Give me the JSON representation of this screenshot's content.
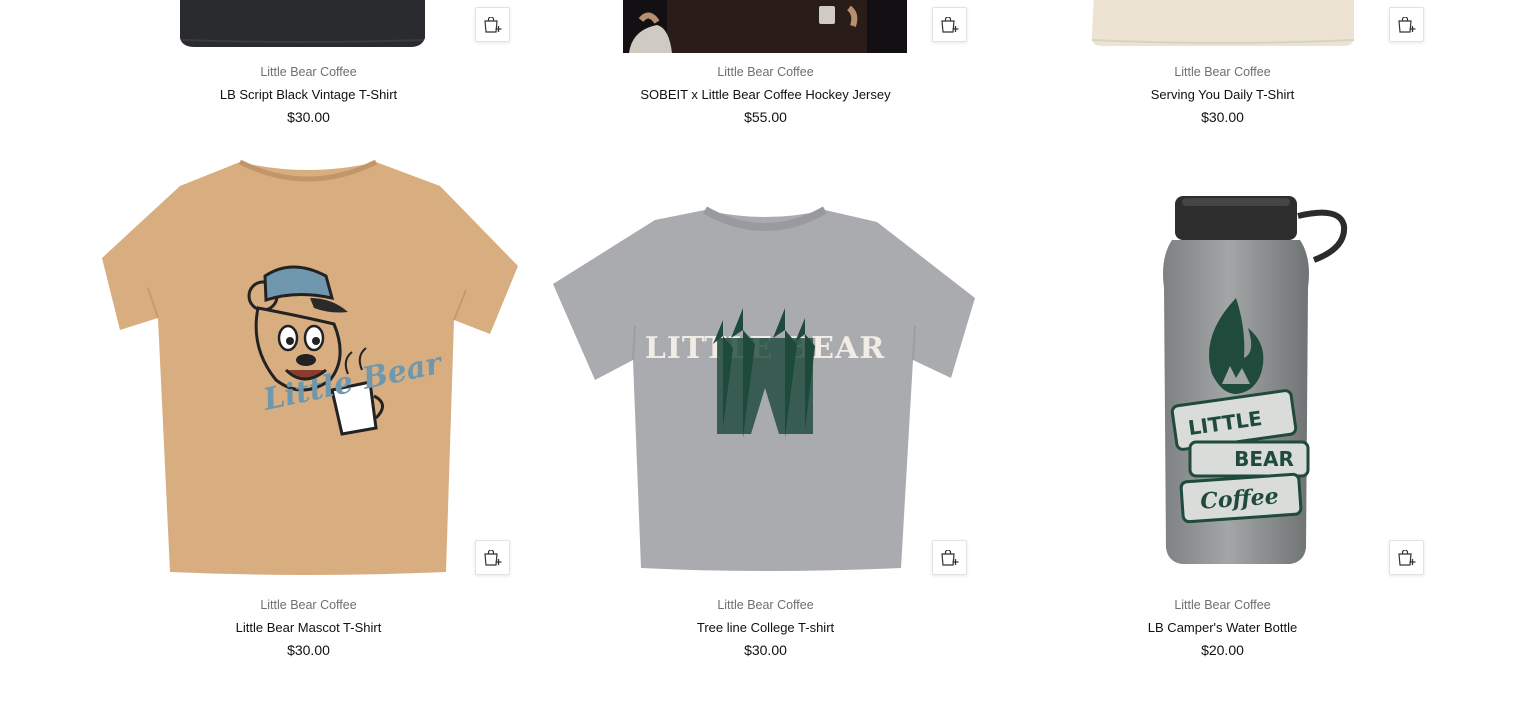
{
  "products_row1": [
    {
      "vendor": "Little Bear Coffee",
      "title": "LB Script Black Vintage T-Shirt",
      "price": "$30.00",
      "icon": "quick-add-cart-icon"
    },
    {
      "vendor": "Little Bear Coffee",
      "title": "SOBEIT x Little Bear Coffee Hockey Jersey",
      "price": "$55.00",
      "icon": "quick-add-cart-icon"
    },
    {
      "vendor": "Little Bear Coffee",
      "title": "Serving You Daily T-Shirt",
      "price": "$30.00",
      "icon": "quick-add-cart-icon"
    }
  ],
  "products_row2": [
    {
      "vendor": "Little Bear Coffee",
      "title": "Little Bear Mascot T-Shirt",
      "price": "$30.00",
      "icon": "quick-add-cart-icon",
      "print_text": "Little Bear"
    },
    {
      "vendor": "Little Bear Coffee",
      "title": "Tree line College T-shirt",
      "price": "$30.00",
      "icon": "quick-add-cart-icon",
      "print_text": "LITTLE BEAR"
    },
    {
      "vendor": "Little Bear Coffee",
      "title": "LB Camper's Water Bottle",
      "price": "$20.00",
      "icon": "quick-add-cart-icon",
      "print_text": [
        "LITTLE",
        "BEAR",
        "Coffee"
      ]
    }
  ],
  "colors": {
    "black_tee": "#2a2b2e",
    "jersey": "#1e1613",
    "cream_tee": "#ece3d3",
    "tan_tee": "#d8ad80",
    "heather_tee": "#a9abaf",
    "bottle": "#8d9090",
    "forest_green": "#1f4a3c",
    "cap_blue": "#6f97ad"
  }
}
